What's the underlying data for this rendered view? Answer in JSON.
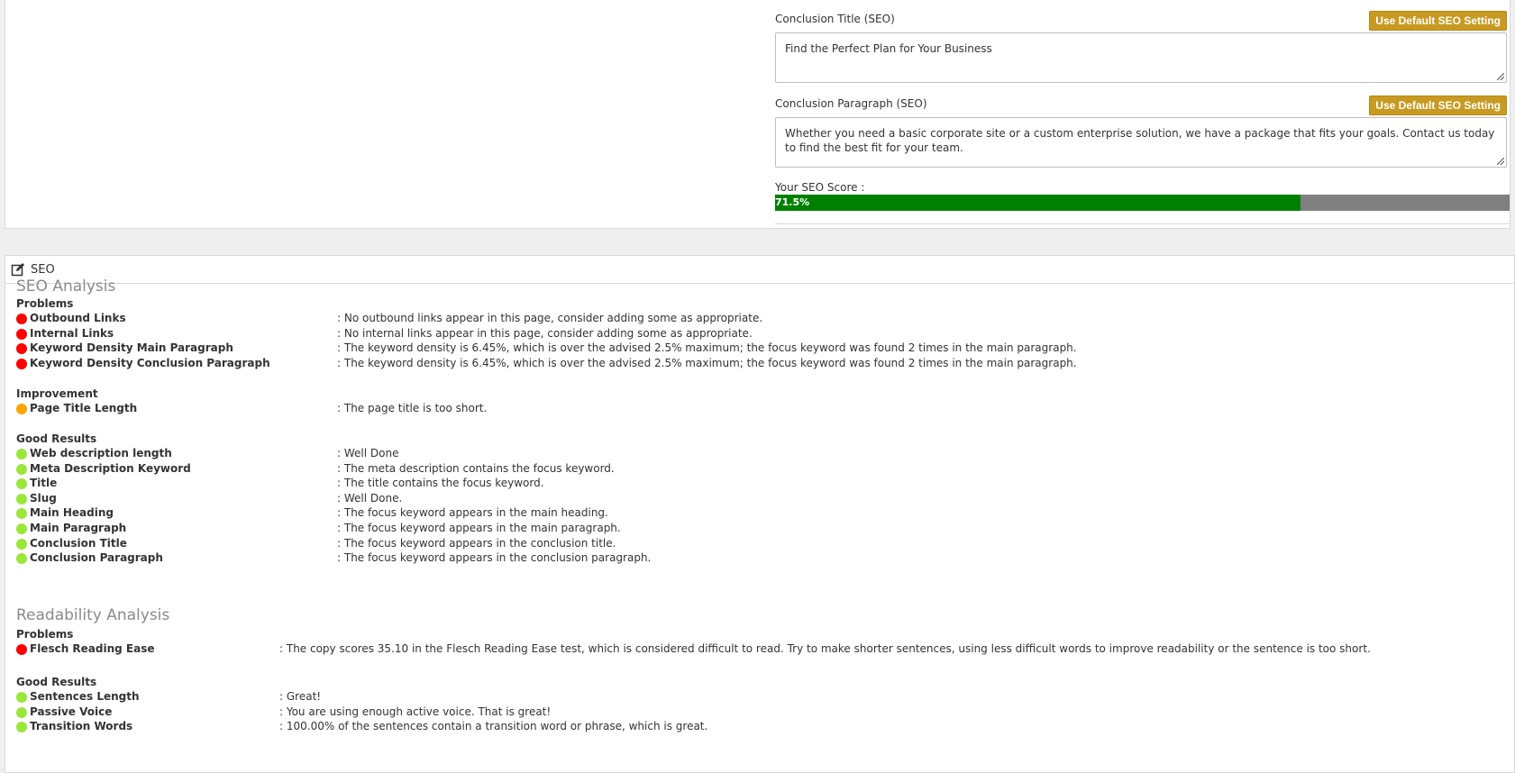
{
  "top": {
    "conclusion_title": {
      "label": "Conclusion Title (SEO)",
      "button": "Use Default SEO Setting",
      "value": "Find the Perfect Plan for Your Business"
    },
    "conclusion_paragraph": {
      "label": "Conclusion Paragraph (SEO)",
      "button": "Use Default SEO Setting",
      "value": "Whether you need a basic corporate site or a custom enterprise solution, we have a package that fits your goals. Contact us today to find the best fit for your team."
    },
    "score": {
      "label": "Your SEO Score :",
      "value_text": "71.5%",
      "value": 71.5,
      "colors": {
        "fill": "#008000",
        "track": "#808080"
      }
    }
  },
  "seo_panel": {
    "header": "SEO",
    "seo_analysis": {
      "title": "SEO Analysis",
      "problems": {
        "title": "Problems",
        "items": [
          {
            "label": "Outbound Links",
            "message": ": No outbound links appear in this page, consider adding some as appropriate."
          },
          {
            "label": "Internal Links",
            "message": ": No internal links appear in this page, consider adding some as appropriate."
          },
          {
            "label": "Keyword Density Main Paragraph",
            "message": ": The keyword density is 6.45%, which is over the advised 2.5% maximum; the focus keyword was found 2 times in the main paragraph."
          },
          {
            "label": "Keyword Density Conclusion Paragraph",
            "message": ": The keyword density is 6.45%, which is over the advised 2.5% maximum; the focus keyword was found 2 times in the main paragraph."
          }
        ]
      },
      "improvement": {
        "title": "Improvement",
        "items": [
          {
            "label": "Page Title Length",
            "message": ": The page title is too short."
          }
        ]
      },
      "good": {
        "title": "Good Results",
        "items": [
          {
            "label": "Web description length",
            "message": ": Well Done"
          },
          {
            "label": "Meta Description Keyword",
            "message": ": The meta description contains the focus keyword."
          },
          {
            "label": "Title",
            "message": ": The title contains the focus keyword."
          },
          {
            "label": "Slug",
            "message": ": Well Done."
          },
          {
            "label": "Main Heading",
            "message": ": The focus keyword appears in the main heading."
          },
          {
            "label": "Main Paragraph",
            "message": ": The focus keyword appears in the main paragraph."
          },
          {
            "label": "Conclusion Title",
            "message": ": The focus keyword appears in the conclusion title."
          },
          {
            "label": "Conclusion Paragraph",
            "message": ": The focus keyword appears in the conclusion paragraph."
          }
        ]
      }
    },
    "readability_analysis": {
      "title": "Readability Analysis",
      "problems": {
        "title": "Problems",
        "items": [
          {
            "label": "Flesch Reading Ease",
            "message": ": The copy scores 35.10 in the Flesch Reading Ease test, which is considered difficult to read. Try to make shorter sentences, using less difficult words to improve readability or the sentence is too short."
          }
        ]
      },
      "good": {
        "title": "Good Results",
        "items": [
          {
            "label": "Sentences Length",
            "message": ": Great!"
          },
          {
            "label": "Passive Voice",
            "message": ": You are using enough active voice. That is great!"
          },
          {
            "label": "Transition Words",
            "message": ": 100.00% of the sentences contain a transition word or phrase, which is great."
          }
        ]
      }
    },
    "status_colors": {
      "problem": "#ff0000",
      "improvement": "#ffa500",
      "good": "#9ae63a"
    },
    "icons": {
      "header": "edit-icon"
    }
  }
}
